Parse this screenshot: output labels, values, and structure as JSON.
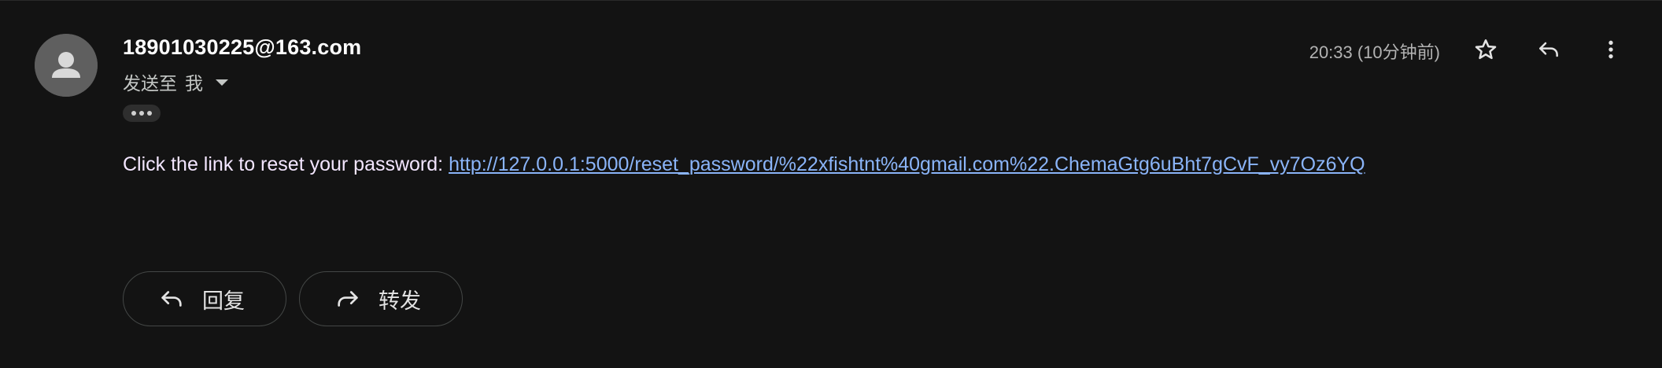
{
  "message": {
    "sender": "18901030225@163.com",
    "recipient_prefix": "发送至",
    "recipient": "我",
    "timestamp": "20:33 (10分钟前)",
    "body_text": "Click the link to reset your password: ",
    "body_link": "http://127.0.0.1:5000/reset_password/%22xfishtnt%40gmail.com%22.ChemaGtg6uBht7gCvF_vy7Oz6YQ"
  },
  "actions": {
    "reply_label": "回复",
    "forward_label": "转发"
  },
  "icons": {
    "avatar": "person-icon",
    "star": "star-outline-icon",
    "reply": "reply-icon",
    "more": "more-vertical-icon",
    "forward": "forward-icon",
    "expand": "chevron-down-icon"
  },
  "colors": {
    "background": "#131313",
    "link": "#8ab4f8",
    "body_text": "#f3e6ff",
    "button_border": "#444746"
  }
}
